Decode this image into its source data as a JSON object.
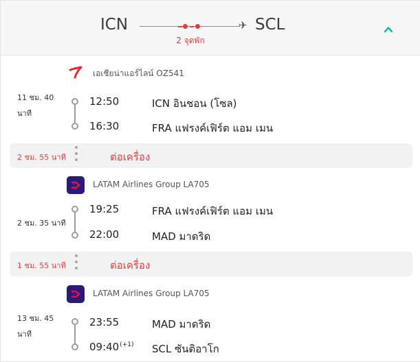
{
  "header": {
    "origin": "ICN",
    "destination": "SCL",
    "stops_label": "2 จุดพัก",
    "colors": {
      "accent": "#00b3b8",
      "stop": "#e0403f"
    }
  },
  "segments": [
    {
      "airline": "เอเชียน่าแอร์ไลน์ OZ541",
      "logo_icon": "asiana-logo-icon",
      "duration": [
        "11 ชม. 40",
        "นาที"
      ],
      "depart_time": "12:50",
      "depart_place": "ICN อินชอน (โซล)",
      "arrive_time": "16:30",
      "arrive_place": "FRA แฟรงค์เฟิร์ต แอม เมน"
    },
    {
      "airline": "LATAM Airlines Group LA705",
      "logo_icon": "latam-logo-icon",
      "duration": [
        "2 ชม. 35 นาที"
      ],
      "depart_time": "19:25",
      "depart_place": "FRA แฟรงค์เฟิร์ต แอม เมน",
      "arrive_time": "22:00",
      "arrive_place": "MAD มาดริด"
    },
    {
      "airline": "LATAM Airlines Group LA705",
      "logo_icon": "latam-logo-icon",
      "duration": [
        "13 ชม. 45",
        "นาที"
      ],
      "depart_time": "23:55",
      "depart_place": "MAD มาดริด",
      "arrive_time": "09:40",
      "arrive_day_offset": "(+1)",
      "arrive_place": "SCL ซันติอาโก"
    }
  ],
  "layovers": [
    {
      "duration": "2 ชม. 55 นาที",
      "label": "ต่อเครื่อง"
    },
    {
      "duration": "1 ชม. 55 นาที",
      "label": "ต่อเครื่อง"
    }
  ]
}
